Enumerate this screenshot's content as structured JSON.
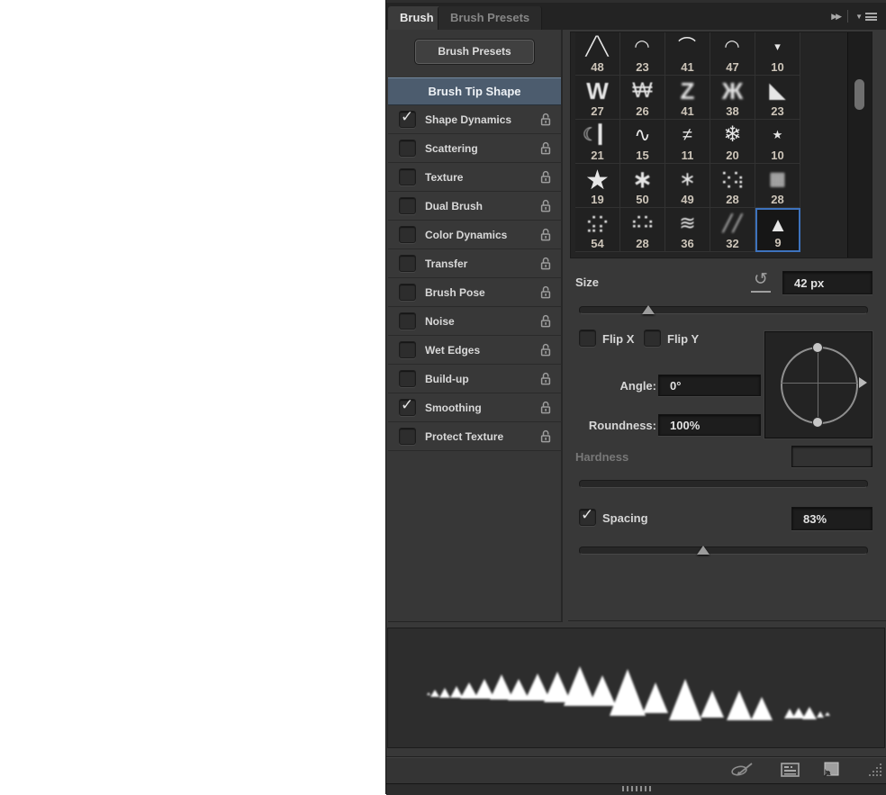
{
  "panel": {
    "tabs": [
      {
        "label": "Brush",
        "active": true
      },
      {
        "label": "Brush Presets",
        "active": false
      }
    ]
  },
  "glyphs": {
    "collapse": "▶▶",
    "menu_arrow": "▼",
    "check": "✓",
    "reset": "↺"
  },
  "sidebar": {
    "presets_button": "Brush Presets",
    "tip_shape": "Brush Tip Shape",
    "items": [
      {
        "label": "Shape Dynamics",
        "checked": true
      },
      {
        "label": "Scattering",
        "checked": false
      },
      {
        "label": "Texture",
        "checked": false
      },
      {
        "label": "Dual Brush",
        "checked": false
      },
      {
        "label": "Color Dynamics",
        "checked": false
      },
      {
        "label": "Transfer",
        "checked": false
      },
      {
        "label": "Brush Pose",
        "checked": false
      },
      {
        "label": "Noise",
        "checked": false
      },
      {
        "label": "Wet Edges",
        "checked": false
      },
      {
        "label": "Build-up",
        "checked": false
      },
      {
        "label": "Smoothing",
        "checked": true
      },
      {
        "label": "Protect Texture",
        "checked": false
      }
    ]
  },
  "grid": {
    "cells": [
      {
        "size": "48",
        "glyph": "╱╲"
      },
      {
        "size": "23",
        "glyph": "◠"
      },
      {
        "size": "41",
        "glyph": "⌒"
      },
      {
        "size": "47",
        "glyph": "◠"
      },
      {
        "size": "10",
        "glyph": "▾"
      },
      {
        "size": "27",
        "glyph": "W"
      },
      {
        "size": "26",
        "glyph": "₩"
      },
      {
        "size": "41",
        "glyph": "Z"
      },
      {
        "size": "38",
        "glyph": "Ж"
      },
      {
        "size": "23",
        "glyph": "◣"
      },
      {
        "size": "21",
        "glyph": "☾▎"
      },
      {
        "size": "15",
        "glyph": "∿"
      },
      {
        "size": "11",
        "glyph": "≠"
      },
      {
        "size": "20",
        "glyph": "❄"
      },
      {
        "size": "10",
        "glyph": "★"
      },
      {
        "size": "19",
        "glyph": "★"
      },
      {
        "size": "50",
        "glyph": "∗"
      },
      {
        "size": "49",
        "glyph": "∗"
      },
      {
        "size": "28",
        "glyph": "⢕⢵"
      },
      {
        "size": "28",
        "glyph": "▦"
      },
      {
        "size": "54",
        "glyph": "⣪⡕"
      },
      {
        "size": "28",
        "glyph": "⠮⠵"
      },
      {
        "size": "36",
        "glyph": "≋"
      },
      {
        "size": "32",
        "glyph": "╱╱"
      },
      {
        "size": "9",
        "glyph": "▲",
        "selected": true
      }
    ]
  },
  "controls": {
    "size": {
      "label": "Size",
      "value": "42 px"
    },
    "flip_x": "Flip X",
    "flip_y": "Flip Y",
    "angle": {
      "label": "Angle:",
      "value": "0°"
    },
    "roundness": {
      "label": "Roundness:",
      "value": "100%"
    },
    "hardness": {
      "label": "Hardness",
      "value": ""
    },
    "spacing": {
      "label": "Spacing",
      "value": "83%",
      "checked": true
    }
  },
  "colors": {
    "panel_bg": "#383838",
    "tabbar_bg": "#232323",
    "selected_row_bg": "#4c5c6e",
    "selection_blue": "#3d72bd",
    "grid_cell_bg": "#212121",
    "number_text": "#cdc5b9",
    "label_text": "#d6d6d6",
    "disabled_text": "#787878"
  }
}
